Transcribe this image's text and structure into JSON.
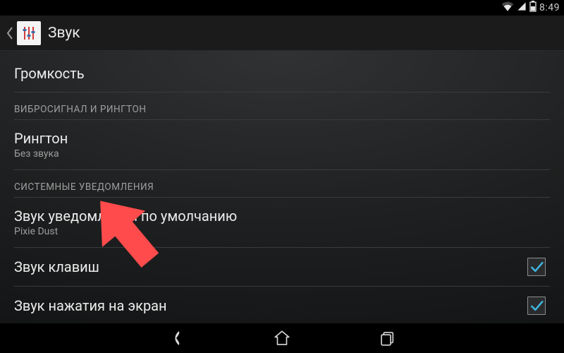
{
  "status_bar": {
    "time": "8:49"
  },
  "action_bar": {
    "title": "Звук"
  },
  "content": {
    "volume_label": "Громкость",
    "section_vibration_ringtone": "ВИБРОСИГНАЛ И РИНГТОН",
    "ringtone": {
      "title": "Рингтон",
      "value": "Без звука"
    },
    "section_system_notifications": "СИСТЕМНЫЕ УВЕДОМЛЕНИЯ",
    "default_notification": {
      "title": "Звук уведомлений по умолчанию",
      "value": "Pixie Dust"
    },
    "dialpad_tones": {
      "title": "Звук клавиш",
      "checked": true
    },
    "touch_sounds": {
      "title": "Звук нажатия на экран",
      "checked": true
    }
  }
}
